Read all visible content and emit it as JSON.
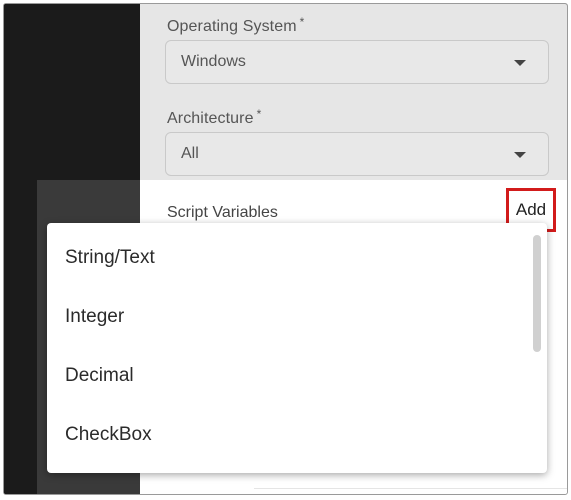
{
  "form": {
    "os_label": "Operating System",
    "os_required": "*",
    "os_value": "Windows",
    "arch_label": "Architecture",
    "arch_required": "*",
    "arch_value": "All"
  },
  "script_variables": {
    "label": "Script Variables",
    "add_label": "Add"
  },
  "menu": {
    "items": [
      "String/Text",
      "Integer",
      "Decimal",
      "CheckBox"
    ]
  },
  "colors": {
    "highlight_border": "#d21b1b"
  }
}
